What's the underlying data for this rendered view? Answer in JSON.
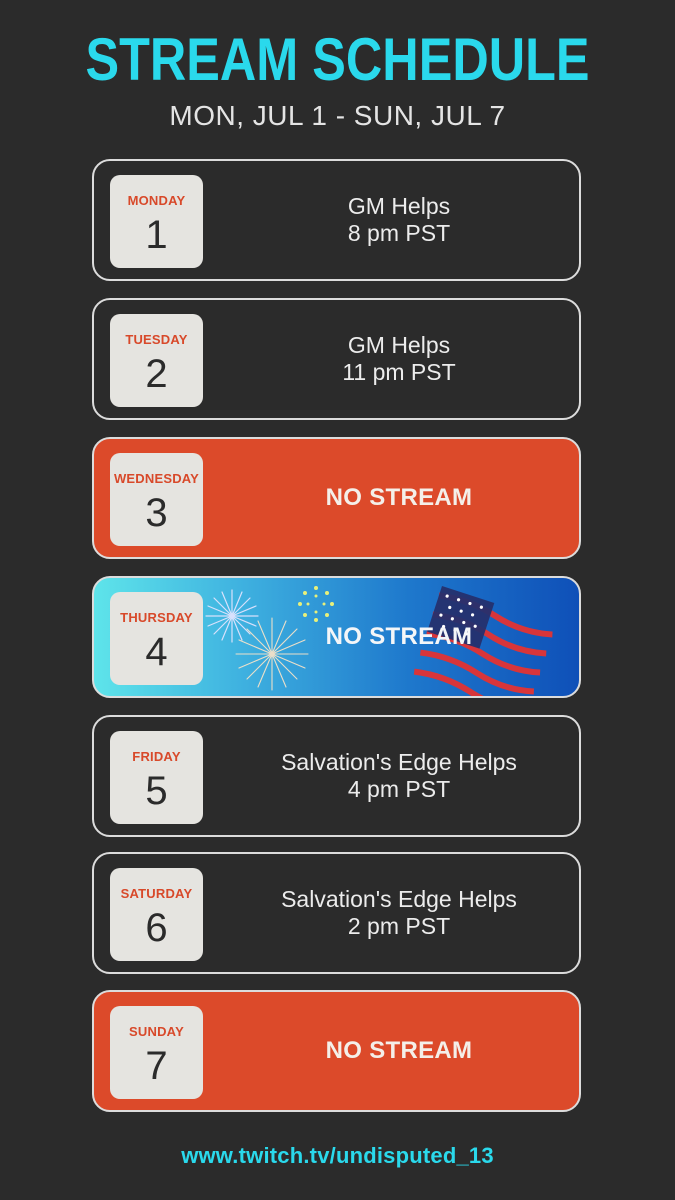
{
  "header": {
    "title": "STREAM SCHEDULE",
    "date_range": "MON, JUL 1 - SUN, JUL 7"
  },
  "colors": {
    "accent": "#2ad9ec",
    "no_stream": "#dc4a2a",
    "background": "#2b2b2b"
  },
  "days": [
    {
      "day": "MONDAY",
      "date": "1",
      "event": "GM Helps",
      "time": "8 pm PST"
    },
    {
      "day": "TUESDAY",
      "date": "2",
      "event": "GM Helps",
      "time": "11 pm PST"
    },
    {
      "day": "WEDNESDAY",
      "date": "3",
      "status": "NO STREAM"
    },
    {
      "day": "THURSDAY",
      "date": "4",
      "status": "NO STREAM"
    },
    {
      "day": "FRIDAY",
      "date": "5",
      "event": "Salvation's Edge Helps",
      "time": "4 pm PST"
    },
    {
      "day": "SATURDAY",
      "date": "6",
      "event": "Salvation's Edge Helps",
      "time": "2 pm PST"
    },
    {
      "day": "SUNDAY",
      "date": "7",
      "status": "NO STREAM"
    }
  ],
  "footer": {
    "url": "www.twitch.tv/undisputed_13"
  }
}
